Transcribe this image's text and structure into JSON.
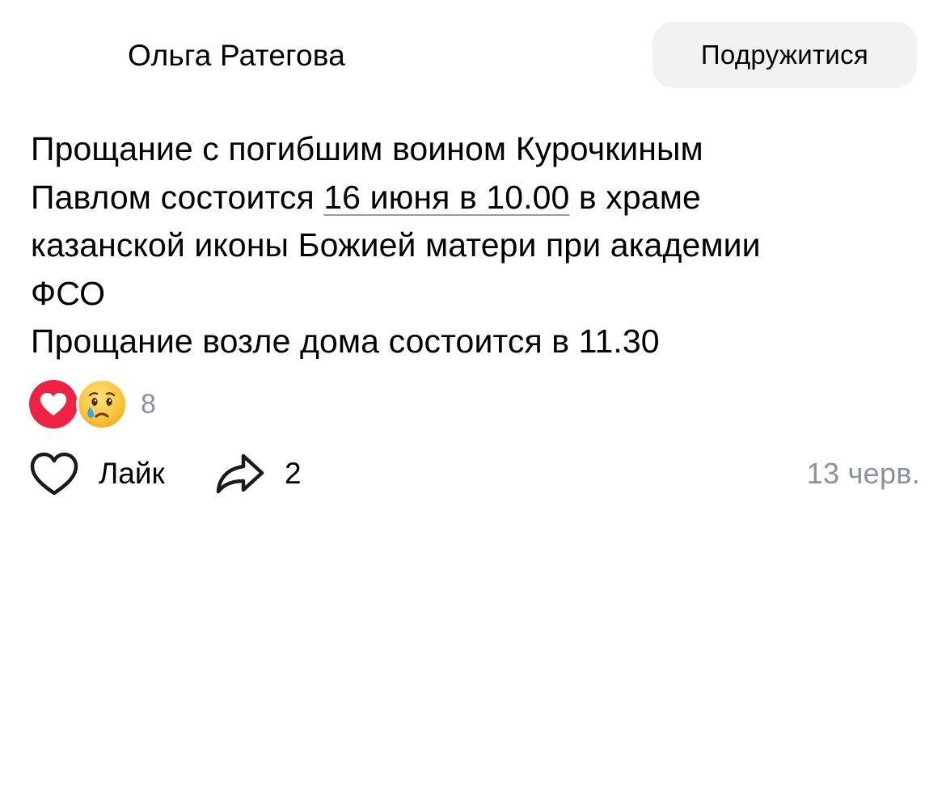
{
  "post": {
    "author_name": "Ольга Ратегова",
    "friend_button_label": "Подружитися",
    "text": {
      "line1": "Прощание с погибшим воином Курочкиным",
      "line2_prefix": "Павлом состоится ",
      "line2_link": "16 июня в 10.00",
      "line2_suffix": " в храме",
      "line3": "казанской иконы Божией матери при академии",
      "line4": "ФСО",
      "line5": "Прощание возле дома состоится в 11.30"
    },
    "reactions": {
      "icons": [
        "heart-reaction-icon",
        "crying-face-reaction-icon"
      ],
      "count": "8"
    },
    "actions": {
      "like_label": "Лайк",
      "share_count": "2"
    },
    "date": "13 черв."
  },
  "colors": {
    "heart_red": "#ee2244",
    "muted_gray": "#8a929d",
    "button_bg": "#f2f2f2"
  }
}
